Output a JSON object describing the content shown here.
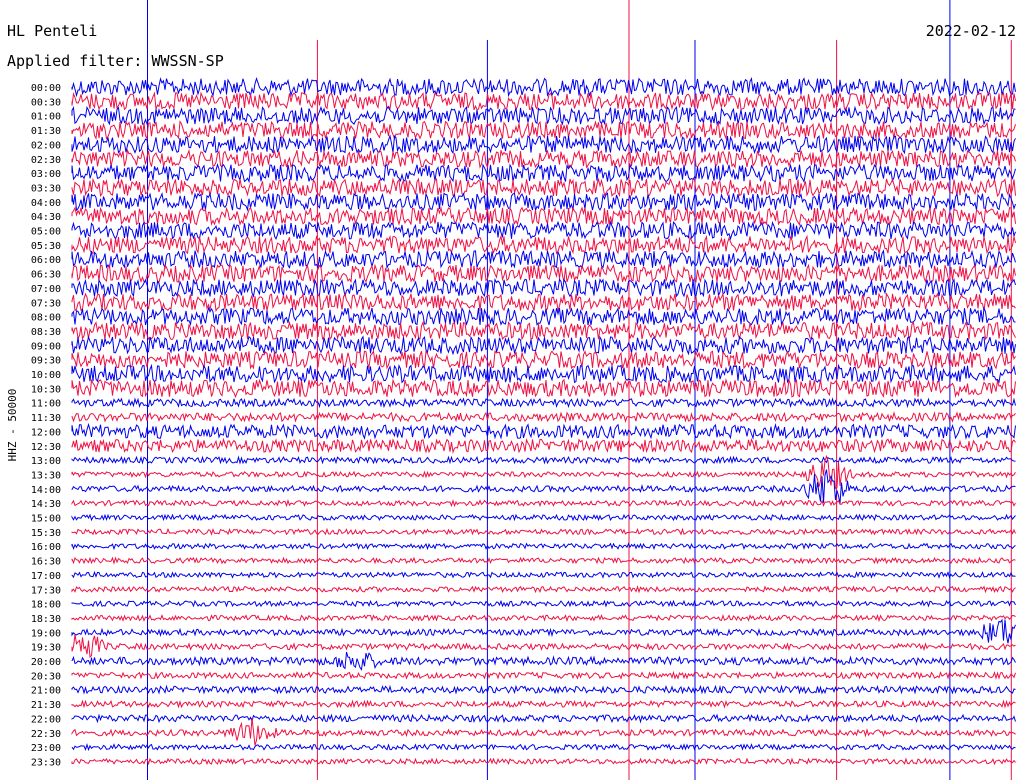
{
  "header": {
    "station": "HL Penteli",
    "date": "2022-02-12",
    "filter": "Applied filter: WWSSN-SP"
  },
  "chart_data": {
    "type": "seismogram",
    "ylabel": "HHZ - 50000",
    "row_labels": [
      "00:00",
      "00:30",
      "01:00",
      "01:30",
      "02:00",
      "02:30",
      "03:00",
      "03:30",
      "04:00",
      "04:30",
      "05:00",
      "05:30",
      "06:00",
      "06:30",
      "07:00",
      "07:30",
      "08:00",
      "08:30",
      "09:00",
      "09:30",
      "10:00",
      "10:30",
      "11:00",
      "11:30",
      "12:00",
      "12:30",
      "13:00",
      "13:30",
      "14:00",
      "14:30",
      "15:00",
      "15:30",
      "16:00",
      "16:30",
      "17:00",
      "17:30",
      "18:00",
      "18:30",
      "19:00",
      "19:30",
      "20:00",
      "20:30",
      "21:00",
      "21:30",
      "22:00",
      "22:30",
      "23:00",
      "23:30"
    ],
    "trace_colors": [
      "#0000ee",
      "#ee1144"
    ],
    "noise_amplitude": [
      1.0,
      1.0,
      1.0,
      1.0,
      1.0,
      1.0,
      1.0,
      1.0,
      1.0,
      1.0,
      1.0,
      1.0,
      1.0,
      1.0,
      1.0,
      1.0,
      1.0,
      1.0,
      1.0,
      1.0,
      1.0,
      1.0,
      0.45,
      0.5,
      0.8,
      0.75,
      0.35,
      0.3,
      0.35,
      0.3,
      0.3,
      0.3,
      0.3,
      0.3,
      0.3,
      0.3,
      0.3,
      0.3,
      0.35,
      0.35,
      0.45,
      0.35,
      0.4,
      0.35,
      0.4,
      0.35,
      0.3,
      0.3
    ],
    "events": [
      {
        "row": 27,
        "t": 0.8,
        "amp": 2.2
      },
      {
        "row": 28,
        "t": 0.8,
        "amp": 2.8
      },
      {
        "row": 38,
        "t": 0.985,
        "amp": 1.8
      },
      {
        "row": 39,
        "t": 0.01,
        "amp": 2.0
      },
      {
        "row": 40,
        "t": 0.3,
        "amp": 1.2
      },
      {
        "row": 45,
        "t": 0.19,
        "amp": 1.6
      }
    ],
    "spikes": [
      0.08,
      0.26,
      0.44,
      0.59,
      0.66,
      0.81,
      0.93,
      0.995
    ]
  }
}
